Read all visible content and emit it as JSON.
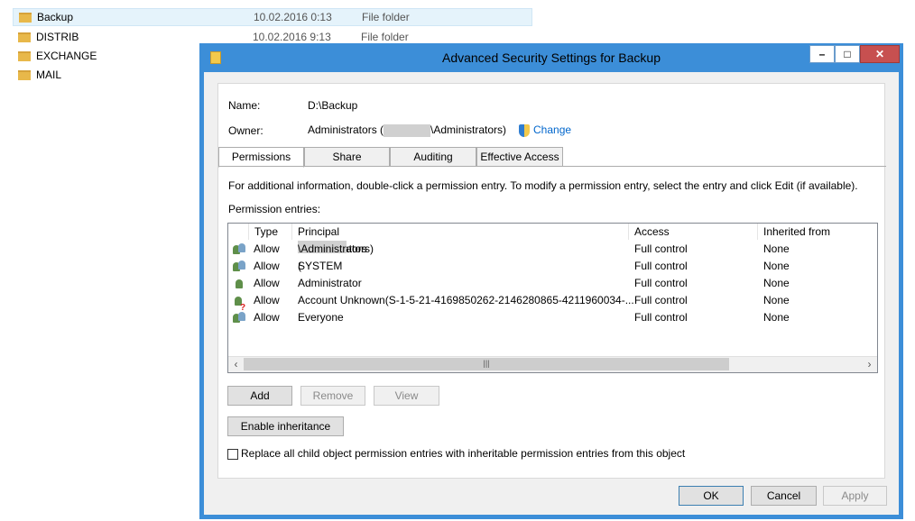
{
  "explorer": {
    "rows": [
      {
        "name": "Backup",
        "date": "10.02.2016 0:13",
        "type": "File folder",
        "selected": true
      },
      {
        "name": "DISTRIB",
        "date": "10.02.2016 9:13",
        "type": "File folder"
      },
      {
        "name": "EXCHANGE",
        "date": "",
        "type": ""
      },
      {
        "name": "MAIL",
        "date": "",
        "type": ""
      }
    ]
  },
  "dialog": {
    "title": "Advanced Security Settings for Backup",
    "name_label": "Name:",
    "name_value": "D:\\Backup",
    "owner_label": "Owner:",
    "owner_prefix": "Administrators (",
    "owner_suffix": "\\Administrators)",
    "change_link": "Change",
    "tabs": [
      "Permissions",
      "Share",
      "Auditing",
      "Effective Access"
    ],
    "info_text": "For additional information, double-click a permission entry. To modify a permission entry, select the entry and click Edit (if available).",
    "entries_label": "Permission entries:",
    "columns": [
      "Type",
      "Principal",
      "Access",
      "Inherited from"
    ],
    "entries": [
      {
        "type": "Allow",
        "principal_pre": "Administrators (",
        "principal_post": "\\Administrators)",
        "access": "Full control",
        "inherited": "None",
        "icon": "group-icon"
      },
      {
        "type": "Allow",
        "principal_pre": "SYSTEM",
        "principal_post": "",
        "access": "Full control",
        "inherited": "None",
        "icon": "group-icon"
      },
      {
        "type": "Allow",
        "principal_pre": "Administrator",
        "principal_post": "",
        "access": "Full control",
        "inherited": "None",
        "icon": "user-icon"
      },
      {
        "type": "Allow",
        "principal_pre": "Account Unknown(S-1-5-21-4169850262-2146280865-4211960034-...",
        "principal_post": "",
        "access": "Full control",
        "inherited": "None",
        "icon": "unknown-user-icon"
      },
      {
        "type": "Allow",
        "principal_pre": "Everyone",
        "principal_post": "",
        "access": "Full control",
        "inherited": "None",
        "icon": "group-icon"
      }
    ],
    "add_button": "Add",
    "remove_button": "Remove",
    "view_button": "View",
    "enable_inheritance_button": "Enable inheritance",
    "replace_checkbox_label": "Replace all child object permission entries with inheritable permission entries from this object",
    "replace_checked": false,
    "ok_button": "OK",
    "cancel_button": "Cancel",
    "apply_button": "Apply"
  }
}
